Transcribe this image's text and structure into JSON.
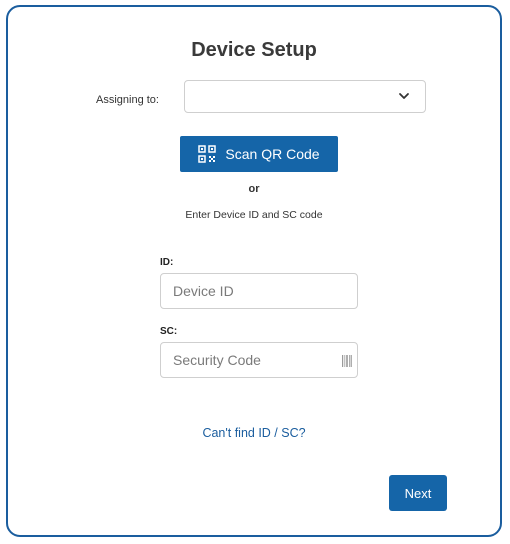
{
  "header": {
    "title": "Device Setup"
  },
  "assign": {
    "label": "Assigning to:",
    "value": "",
    "icon": "chevron-down-icon"
  },
  "scan": {
    "label": "Scan QR Code",
    "icon": "qr-code-icon"
  },
  "divider": {
    "or": "or",
    "instruction": "Enter Device ID and SC code"
  },
  "id_field": {
    "label": "ID:",
    "placeholder": "Device ID",
    "value": ""
  },
  "sc_field": {
    "label": "SC:",
    "placeholder": "Security Code",
    "value": "",
    "icon": "barcode-icon"
  },
  "help": {
    "link_text": "Can't find ID / SC?"
  },
  "actions": {
    "next_label": "Next"
  },
  "colors": {
    "accent": "#1565a8",
    "border": "#1a5d9e",
    "link": "#1a5d9e"
  }
}
